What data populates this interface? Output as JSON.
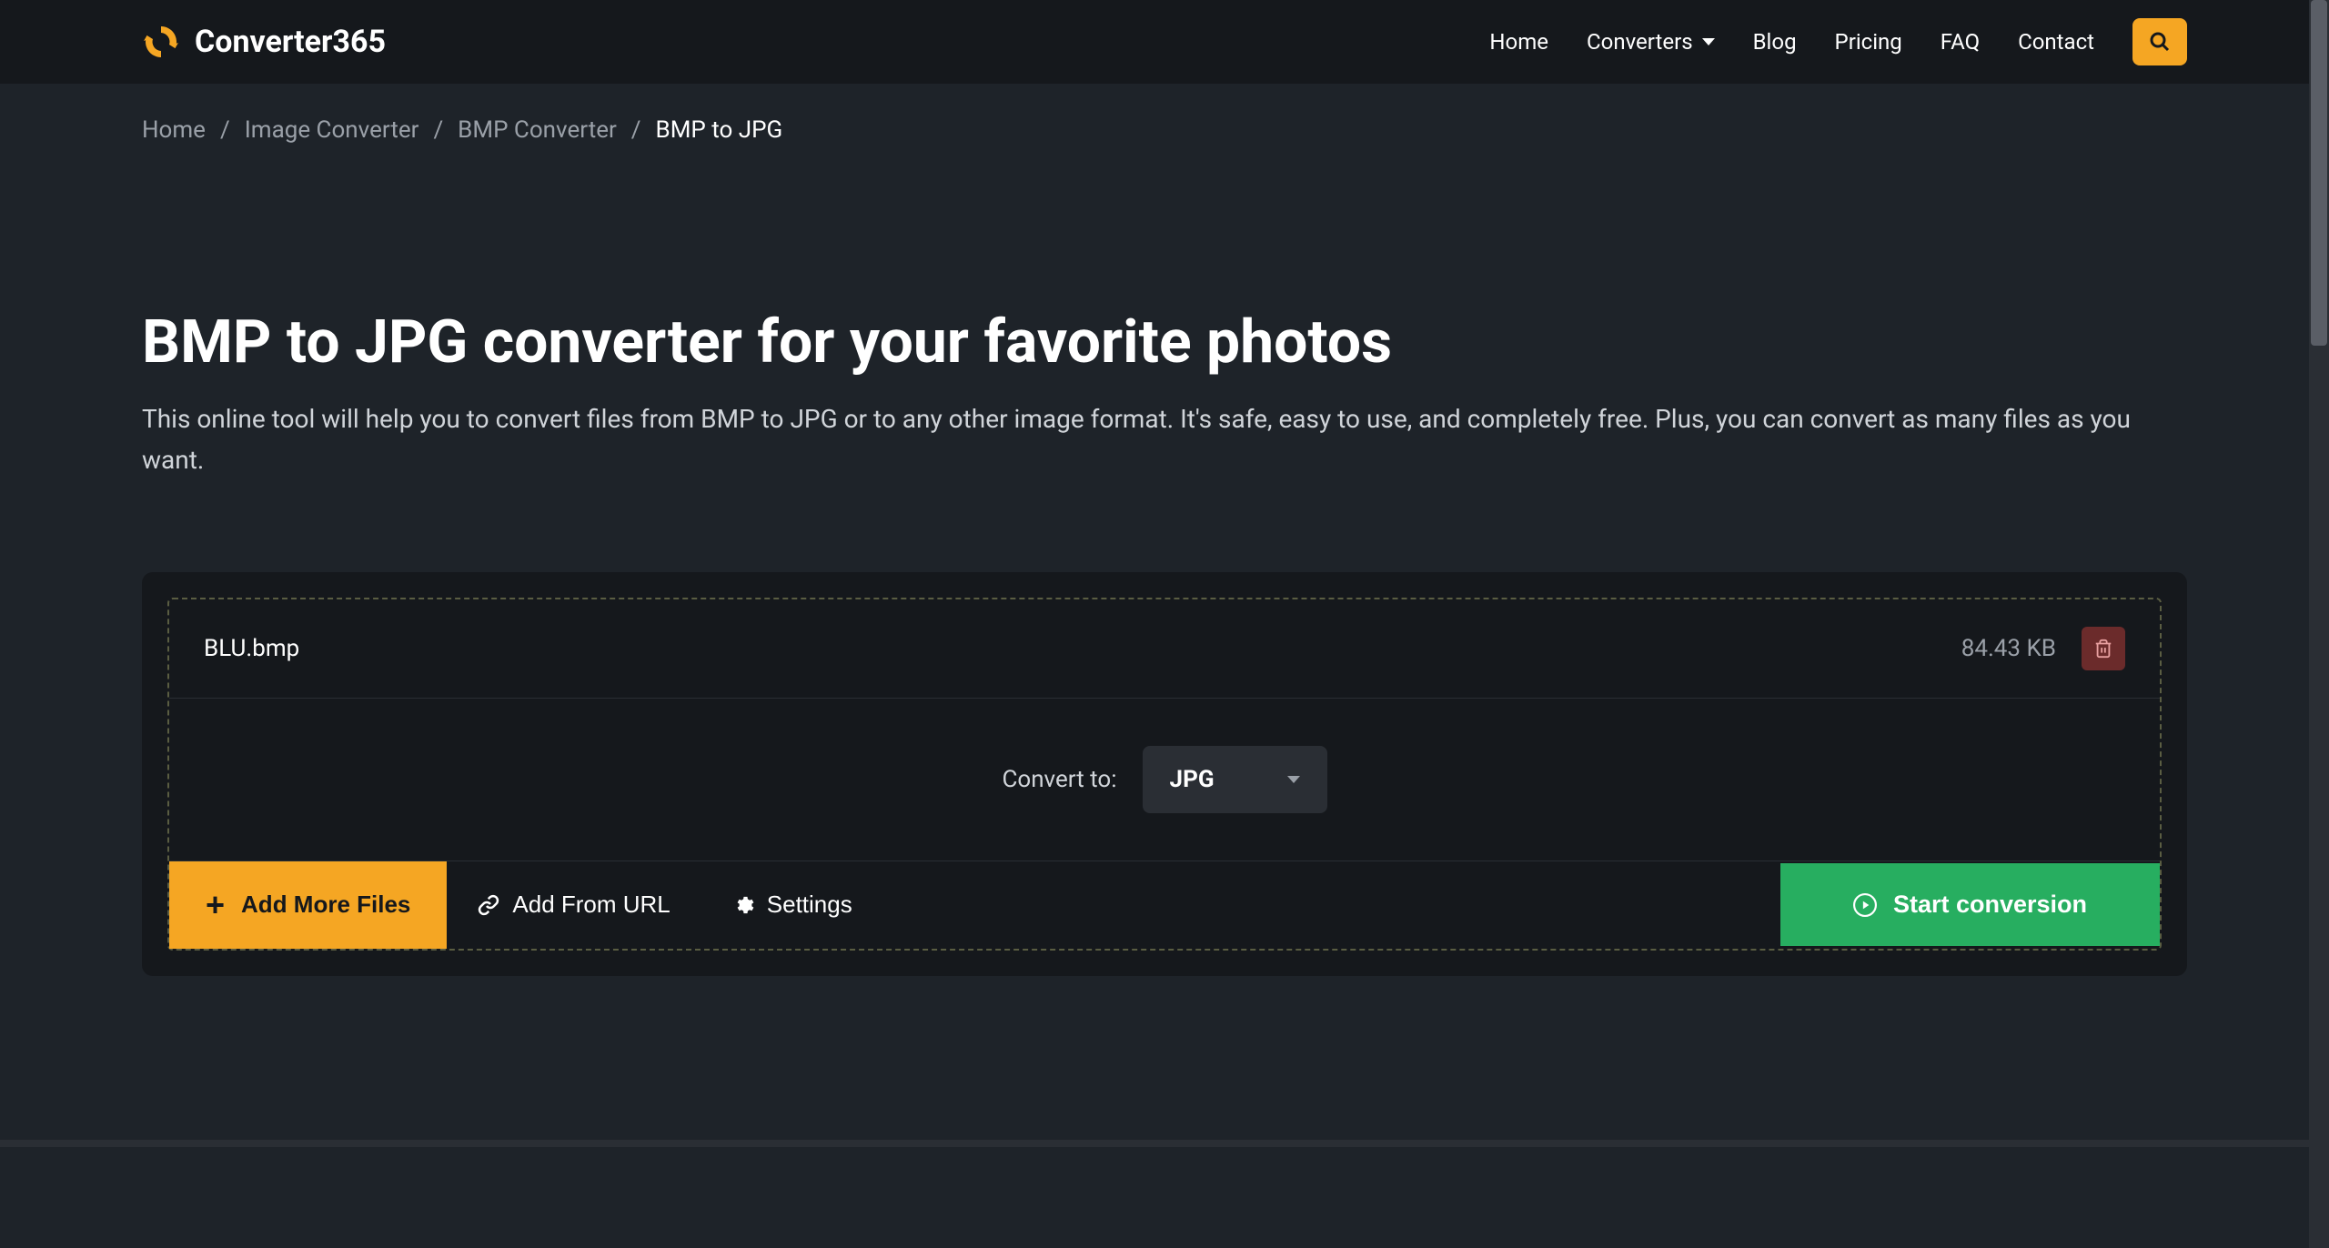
{
  "header": {
    "logo_text": "Converter365",
    "nav": {
      "home": "Home",
      "converters": "Converters",
      "blog": "Blog",
      "pricing": "Pricing",
      "faq": "FAQ",
      "contact": "Contact"
    }
  },
  "breadcrumb": {
    "home": "Home",
    "image_converter": "Image Converter",
    "bmp_converter": "BMP Converter",
    "current": "BMP to JPG"
  },
  "main": {
    "title": "BMP to JPG converter for your favorite photos",
    "description": "This online tool will help you to convert files from BMP to JPG or to any other image format. It's safe, easy to use, and completely free. Plus, you can convert as many files as you want."
  },
  "converter": {
    "file_name": "BLU.bmp",
    "file_size": "84.43 KB",
    "convert_to_label": "Convert to:",
    "format_value": "JPG",
    "add_more_files": "Add More Files",
    "add_from_url": "Add From URL",
    "settings": "Settings",
    "start_conversion": "Start conversion"
  },
  "colors": {
    "accent": "#f5a623",
    "success": "#27ae60",
    "danger": "#6b2b2b"
  }
}
